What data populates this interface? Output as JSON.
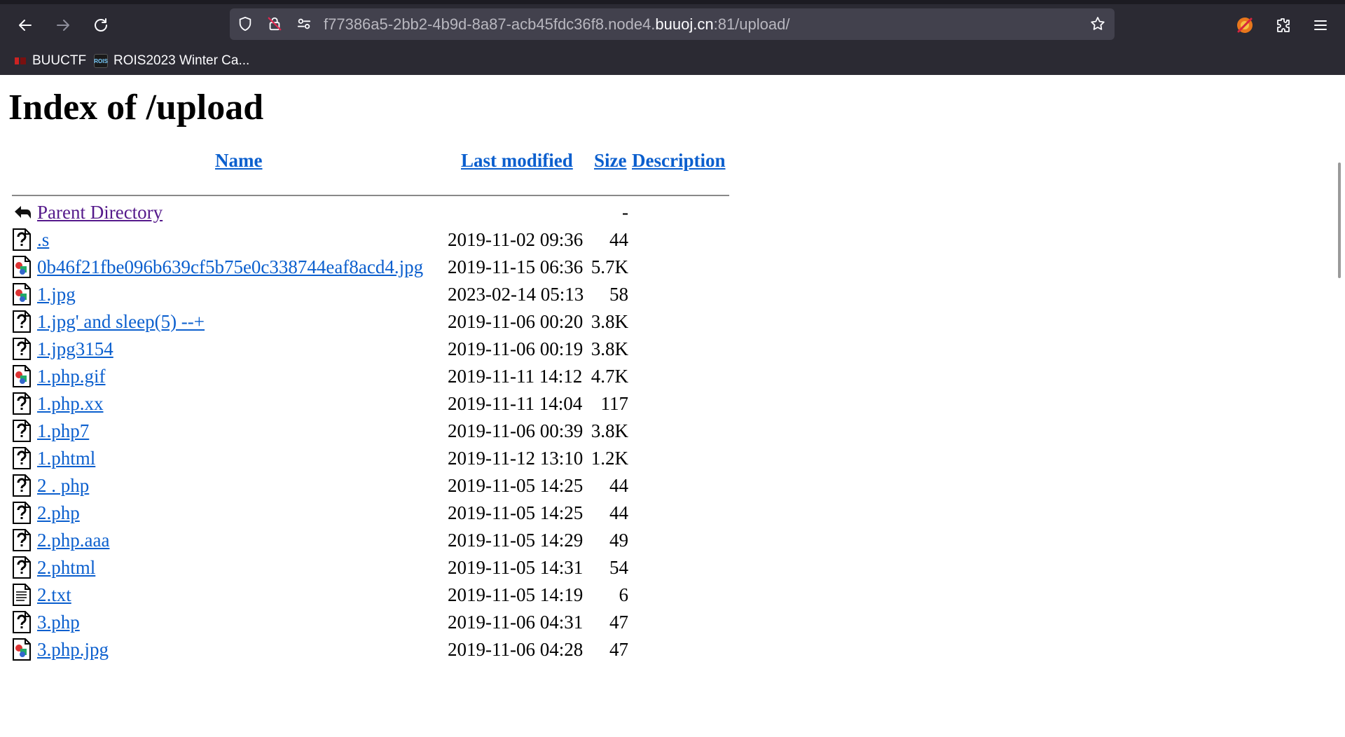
{
  "browser": {
    "url": {
      "prefix": "f77386a5-2bb2-4b9d-8a87-acb45fdc36f8.node4.",
      "domain": "buuoj.cn",
      "suffix": ":81/upload/"
    },
    "bookmarks": [
      {
        "label": "BUUCTF",
        "icon": "buuctf-favicon"
      },
      {
        "label": "ROIS2023 Winter Ca...",
        "icon": "rois-favicon",
        "icon_text": "ROIS"
      }
    ],
    "colors": {
      "chrome": "#2b2a33",
      "urlbar": "#42414d"
    }
  },
  "page": {
    "title": "Index of /upload",
    "columns": {
      "name": "Name",
      "last_modified": "Last modified",
      "size": "Size",
      "description": "Description"
    },
    "rows": [
      {
        "icon": "back-icon",
        "name": "Parent Directory",
        "date": "",
        "size": "-"
      },
      {
        "icon": "unknown-file-icon",
        "name": ".s",
        "date": "2019-11-02 09:36",
        "size": "44"
      },
      {
        "icon": "image-file-icon",
        "name": "0b46f21fbe096b639cf5b75e0c338744eaf8acd4.jpg",
        "date": "2019-11-15 06:36",
        "size": "5.7K"
      },
      {
        "icon": "image-file-icon",
        "name": "1.jpg",
        "date": "2023-02-14 05:13",
        "size": "58"
      },
      {
        "icon": "unknown-file-icon",
        "name": "1.jpg' and sleep(5) --+",
        "date": "2019-11-06 00:20",
        "size": "3.8K"
      },
      {
        "icon": "unknown-file-icon",
        "name": "1.jpg3154",
        "date": "2019-11-06 00:19",
        "size": "3.8K"
      },
      {
        "icon": "image-file-icon",
        "name": "1.php.gif",
        "date": "2019-11-11 14:12",
        "size": "4.7K"
      },
      {
        "icon": "unknown-file-icon",
        "name": "1.php.xx",
        "date": "2019-11-11 14:04",
        "size": "117"
      },
      {
        "icon": "unknown-file-icon",
        "name": "1.php7",
        "date": "2019-11-06 00:39",
        "size": "3.8K"
      },
      {
        "icon": "unknown-file-icon",
        "name": "1.phtml",
        "date": "2019-11-12 13:10",
        "size": "1.2K"
      },
      {
        "icon": "unknown-file-icon",
        "name": "2 . php",
        "date": "2019-11-05 14:25",
        "size": "44"
      },
      {
        "icon": "unknown-file-icon",
        "name": "2.php",
        "date": "2019-11-05 14:25",
        "size": "44"
      },
      {
        "icon": "unknown-file-icon",
        "name": "2.php.aaa",
        "date": "2019-11-05 14:29",
        "size": "49"
      },
      {
        "icon": "unknown-file-icon",
        "name": "2.phtml",
        "date": "2019-11-05 14:31",
        "size": "54"
      },
      {
        "icon": "text-file-icon",
        "name": "2.txt",
        "date": "2019-11-05 14:19",
        "size": "6"
      },
      {
        "icon": "unknown-file-icon",
        "name": "3.php",
        "date": "2019-11-06 04:31",
        "size": "47"
      },
      {
        "icon": "image-file-icon",
        "name": "3.php.jpg",
        "date": "2019-11-06 04:28",
        "size": "47"
      }
    ],
    "colors": {
      "link": "#0b5fce",
      "visited": "#551a8b"
    }
  }
}
